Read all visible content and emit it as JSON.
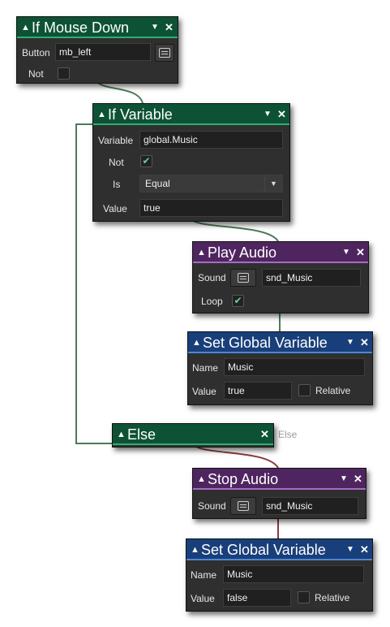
{
  "colors": {
    "event_green": "#0d5235",
    "audio_purple": "#4f2560",
    "variable_blue": "#193f7a",
    "true_line": "#4e7b59",
    "false_line": "#8a3a3a"
  },
  "icons": {
    "collapse": "▲",
    "menu": "▼",
    "close": "✕",
    "check": "✔",
    "resource_picker": "resource-picker-icon"
  },
  "if_mouse_down": {
    "title": "If Mouse Down",
    "button_label": "Button",
    "button_value": "mb_left",
    "not_label": "Not",
    "not_checked": false
  },
  "if_variable": {
    "title": "If Variable",
    "variable_label": "Variable",
    "variable_value": "global.Music",
    "not_label": "Not",
    "not_checked": true,
    "is_label": "Is",
    "is_value": "Equal",
    "value_label": "Value",
    "value_value": "true"
  },
  "play_audio": {
    "title": "Play Audio",
    "sound_label": "Sound",
    "sound_value": "snd_Music",
    "loop_label": "Loop",
    "loop_checked": true
  },
  "set_global_1": {
    "title": "Set Global Variable",
    "name_label": "Name",
    "name_value": "Music",
    "value_label": "Value",
    "value_value": "true",
    "relative_label": "Relative",
    "relative_checked": false
  },
  "else_node": {
    "title": "Else",
    "side_label": "Else"
  },
  "stop_audio": {
    "title": "Stop Audio",
    "sound_label": "Sound",
    "sound_value": "snd_Music"
  },
  "set_global_2": {
    "title": "Set Global Variable",
    "name_label": "Name",
    "name_value": "Music",
    "value_label": "Value",
    "value_value": "false",
    "relative_label": "Relative",
    "relative_checked": false
  }
}
